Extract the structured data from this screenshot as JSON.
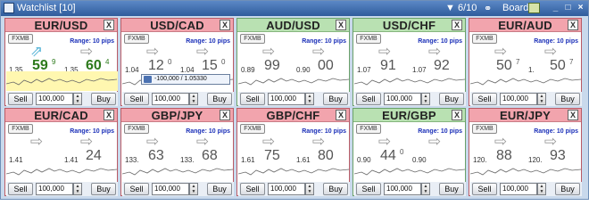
{
  "window": {
    "title": "Watchlist [10]",
    "filter_count": "6/10",
    "board_label": "Board"
  },
  "tooltip": "-100,000 / 1.05330",
  "cards": [
    {
      "symbol": "EUR/USD",
      "color": "red",
      "range": "Range: 10 pips",
      "bid_small": "1.35",
      "bid_big": "59",
      "bid_sup": "9",
      "ask_small": "1.35",
      "ask_big": "60",
      "ask_sup": "4",
      "qty": "100,000",
      "sell": "Sell",
      "buy": "Buy",
      "logo": "FXMB",
      "highlight": true,
      "arrow": "up"
    },
    {
      "symbol": "USD/CAD",
      "color": "red",
      "range": "Range: 10 pips",
      "bid_small": "1.04",
      "bid_big": "12",
      "bid_sup": "0",
      "ask_small": "1.04",
      "ask_big": "15",
      "ask_sup": "0",
      "qty": "100,000",
      "sell": "Sell",
      "buy": "Buy",
      "logo": "FXMB",
      "highlight": false,
      "arrow": "right"
    },
    {
      "symbol": "AUD/USD",
      "color": "green",
      "range": "Range: 10 pips",
      "bid_small": "0.89",
      "bid_big": "99",
      "bid_sup": "",
      "ask_small": "0.90",
      "ask_big": "00",
      "ask_sup": "",
      "qty": "100,000",
      "sell": "Sell",
      "buy": "Buy",
      "logo": "FXMB",
      "highlight": false,
      "arrow": "right"
    },
    {
      "symbol": "USD/CHF",
      "color": "green",
      "range": "Range: 10 pips",
      "bid_small": "1.07",
      "bid_big": "91",
      "bid_sup": "",
      "ask_small": "1.07",
      "ask_big": "92",
      "ask_sup": "",
      "qty": "100,000",
      "sell": "Sell",
      "buy": "Buy",
      "logo": "FXMB",
      "highlight": false,
      "arrow": "right"
    },
    {
      "symbol": "EUR/AUD",
      "color": "red",
      "range": "Range: 10 pips",
      "bid_small": "",
      "bid_big": "50",
      "bid_sup": "7",
      "ask_small": "1.",
      "ask_big": "50",
      "ask_sup": "7",
      "qty": "100,000",
      "sell": "Sell",
      "buy": "Buy",
      "logo": "FXMB",
      "highlight": false,
      "arrow": "right"
    },
    {
      "symbol": "EUR/CAD",
      "color": "red",
      "range": "Range: 10 pips",
      "bid_small": "1.41",
      "bid_big": "",
      "bid_sup": "",
      "ask_small": "1.41",
      "ask_big": "24",
      "ask_sup": "",
      "qty": "100,000",
      "sell": "Sell",
      "buy": "Buy",
      "logo": "FXMB",
      "highlight": false,
      "arrow": "right"
    },
    {
      "symbol": "GBP/JPY",
      "color": "red",
      "range": "Range: 10 pips",
      "bid_small": "133.",
      "bid_big": "63",
      "bid_sup": "",
      "ask_small": "133.",
      "ask_big": "68",
      "ask_sup": "",
      "qty": "100,000",
      "sell": "Sell",
      "buy": "Buy",
      "logo": "FXMB",
      "highlight": false,
      "arrow": "right"
    },
    {
      "symbol": "GBP/CHF",
      "color": "red",
      "range": "Range: 10 pips",
      "bid_small": "1.61",
      "bid_big": "75",
      "bid_sup": "",
      "ask_small": "1.61",
      "ask_big": "80",
      "ask_sup": "",
      "qty": "100,000",
      "sell": "Sell",
      "buy": "Buy",
      "logo": "FXMB",
      "highlight": false,
      "arrow": "right"
    },
    {
      "symbol": "EUR/GBP",
      "color": "green",
      "range": "Range: 10 pips",
      "bid_small": "0.90",
      "bid_big": "44",
      "bid_sup": "0",
      "ask_small": "0.90",
      "ask_big": "",
      "ask_sup": "",
      "qty": "100,000",
      "sell": "Sell",
      "buy": "Buy",
      "logo": "FXMB",
      "highlight": false,
      "arrow": "right"
    },
    {
      "symbol": "EUR/JPY",
      "color": "red",
      "range": "Range: 10 pips",
      "bid_small": "120.",
      "bid_big": "88",
      "bid_sup": "",
      "ask_small": "120.",
      "ask_big": "93",
      "ask_sup": "",
      "qty": "100,000",
      "sell": "Sell",
      "buy": "Buy",
      "logo": "FXMB",
      "highlight": false,
      "arrow": "right"
    }
  ]
}
